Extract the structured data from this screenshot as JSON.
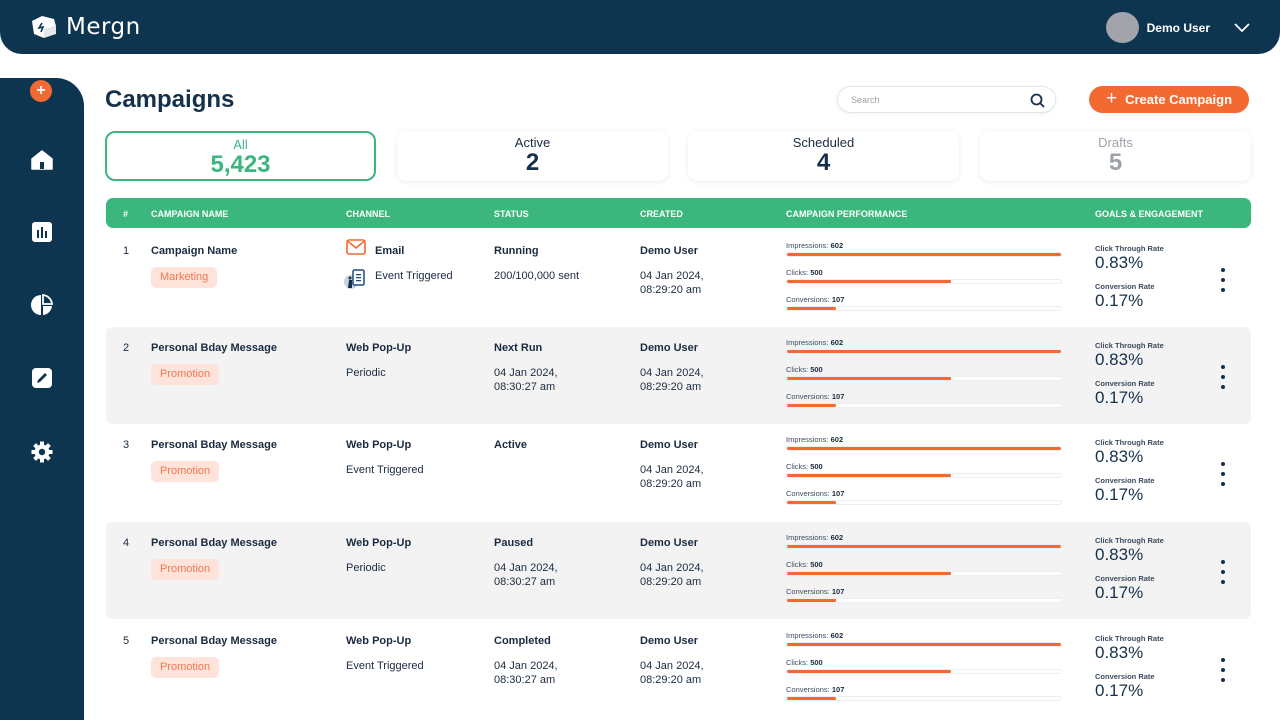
{
  "app": {
    "name": "Mergn"
  },
  "header": {
    "user_name": "Demo User"
  },
  "sidebar": {
    "add_label": "+",
    "items": [
      {
        "icon": "home-icon"
      },
      {
        "icon": "bar-chart-icon"
      },
      {
        "icon": "pie-chart-icon"
      },
      {
        "icon": "edit-icon"
      },
      {
        "icon": "gear-icon"
      }
    ]
  },
  "page": {
    "title": "Campaigns",
    "search_placeholder": "Search",
    "create_label": "Create Campaign"
  },
  "stats": [
    {
      "label": "All",
      "value": "5,423",
      "selected": true
    },
    {
      "label": "Active",
      "value": "2"
    },
    {
      "label": "Scheduled",
      "value": "4"
    },
    {
      "label": "Drafts",
      "value": "5"
    }
  ],
  "colors": {
    "accent": "#f26932",
    "green": "#3bb77e",
    "navy": "#0d3550"
  },
  "table": {
    "columns": [
      "#",
      "CAMPAIGN NAME",
      "CHANNEL",
      "STATUS",
      "CREATED",
      "CAMPAIGN PERFORMANCE",
      "GOALS & ENGAGEMENT"
    ],
    "rows": [
      {
        "index": "1",
        "name": "Campaign Name",
        "tag": "Marketing",
        "channel": "Email",
        "channel_type": "Event Triggered",
        "status": "Running",
        "status_detail": "200/100,000 sent",
        "created_by": "Demo User",
        "created_at": "04 Jan 2024,\n08:29:20 am",
        "perf": [
          {
            "label": "Impressions:",
            "value": "602",
            "pct": 100
          },
          {
            "label": "Clicks:",
            "value": "500",
            "pct": 60
          },
          {
            "label": "Conversions:",
            "value": "107",
            "pct": 18
          }
        ],
        "ctr_label": "Click Through Rate",
        "ctr": "0.83%",
        "cvr_label": "Conversion Rate",
        "cvr": "0.17%"
      },
      {
        "index": "2",
        "name": "Personal Bday Message",
        "tag": "Promotion",
        "channel": "Web Pop-Up",
        "channel_type": "Periodic",
        "status": "Next Run",
        "status_detail": "04 Jan 2024,\n08:30:27 am",
        "created_by": "Demo User",
        "created_at": "04 Jan 2024,\n08:29:20 am",
        "perf": [
          {
            "label": "Impressions:",
            "value": "602",
            "pct": 100
          },
          {
            "label": "Clicks:",
            "value": "500",
            "pct": 60
          },
          {
            "label": "Conversions:",
            "value": "107",
            "pct": 18
          }
        ],
        "ctr_label": "Click Through Rate",
        "ctr": "0.83%",
        "cvr_label": "Conversion Rate",
        "cvr": "0.17%"
      },
      {
        "index": "3",
        "name": "Personal Bday Message",
        "tag": "Promotion",
        "channel": "Web Pop-Up",
        "channel_type": "Event Triggered",
        "status": "Active",
        "status_detail": "",
        "created_by": "Demo User",
        "created_at": "04 Jan 2024,\n08:29:20 am",
        "perf": [
          {
            "label": "Impressions:",
            "value": "602",
            "pct": 100
          },
          {
            "label": "Clicks:",
            "value": "500",
            "pct": 60
          },
          {
            "label": "Conversions:",
            "value": "107",
            "pct": 18
          }
        ],
        "ctr_label": "Click Through Rate",
        "ctr": "0.83%",
        "cvr_label": "Conversion Rate",
        "cvr": "0.17%"
      },
      {
        "index": "4",
        "name": "Personal Bday Message",
        "tag": "Promotion",
        "channel": "Web Pop-Up",
        "channel_type": "Periodic",
        "status": "Paused",
        "status_detail": "04 Jan 2024,\n08:30:27 am",
        "created_by": "Demo User",
        "created_at": "04 Jan 2024,\n08:29:20 am",
        "perf": [
          {
            "label": "Impressions:",
            "value": "602",
            "pct": 100
          },
          {
            "label": "Clicks:",
            "value": "500",
            "pct": 60
          },
          {
            "label": "Conversions:",
            "value": "107",
            "pct": 18
          }
        ],
        "ctr_label": "Click Through Rate",
        "ctr": "0.83%",
        "cvr_label": "Conversion Rate",
        "cvr": "0.17%"
      },
      {
        "index": "5",
        "name": "Personal Bday Message",
        "tag": "Promotion",
        "channel": "Web Pop-Up",
        "channel_type": "Event Triggered",
        "status": "Completed",
        "status_detail": "04 Jan 2024,\n08:30:27 am",
        "created_by": "Demo User",
        "created_at": "04 Jan 2024,\n08:29:20 am",
        "perf": [
          {
            "label": "Impressions:",
            "value": "602",
            "pct": 100
          },
          {
            "label": "Clicks:",
            "value": "500",
            "pct": 60
          },
          {
            "label": "Conversions:",
            "value": "107",
            "pct": 18
          }
        ],
        "ctr_label": "Click Through Rate",
        "ctr": "0.83%",
        "cvr_label": "Conversion Rate",
        "cvr": "0.17%"
      }
    ]
  }
}
